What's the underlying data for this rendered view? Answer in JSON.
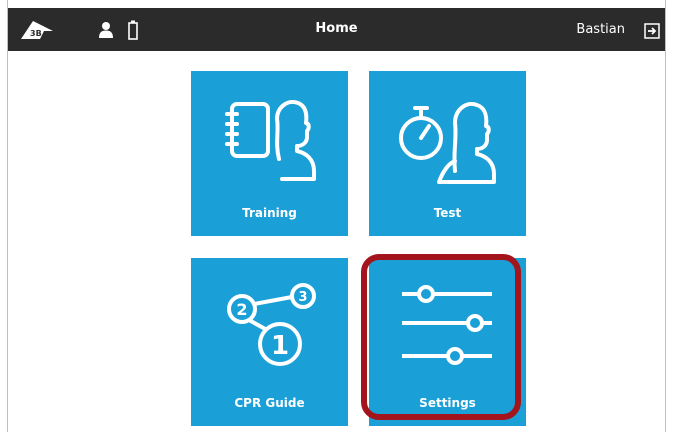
{
  "header": {
    "title": "Home",
    "username": "Bastian",
    "icons": [
      "3b-logo-icon",
      "user-icon",
      "battery-icon",
      "logout-icon"
    ]
  },
  "tiles": [
    {
      "label": "Training",
      "icon": "notebook-head-icon"
    },
    {
      "label": "Test",
      "icon": "stopwatch-head-icon"
    },
    {
      "label": "CPR Guide",
      "icon": "steps-123-icon"
    },
    {
      "label": "Settings",
      "icon": "sliders-icon"
    }
  ],
  "colors": {
    "header_bg": "#2b2b2b",
    "tile_bg": "#1a9fd7",
    "highlight": "#a3141c"
  }
}
